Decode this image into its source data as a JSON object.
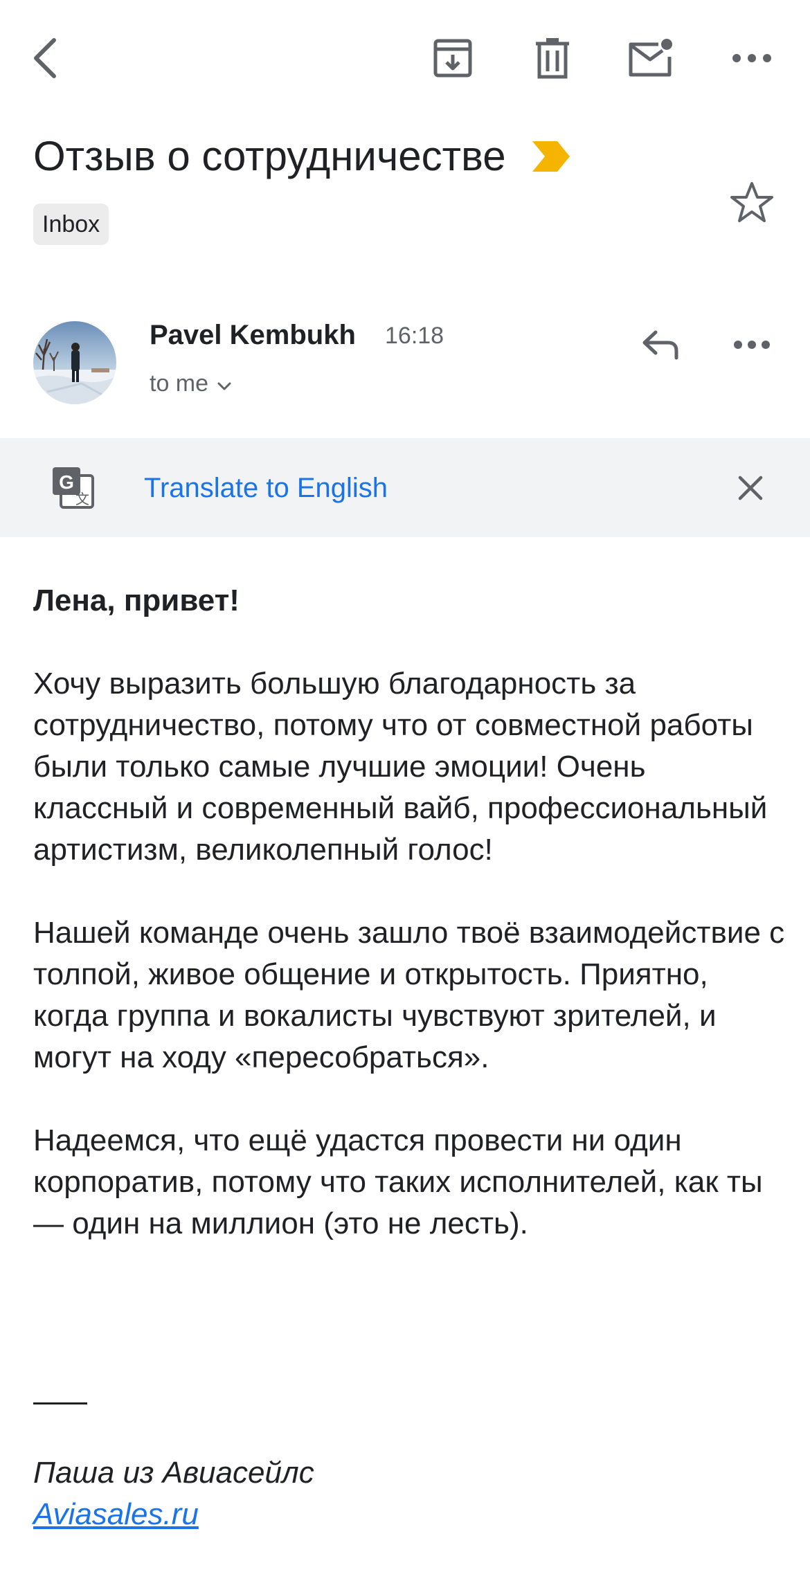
{
  "toolbar": {
    "back_icon": "arrow-back-icon",
    "archive_icon": "archive-icon",
    "delete_icon": "trash-icon",
    "mark_unread_icon": "mark-unread-icon",
    "more_icon": "more-horizontal-icon"
  },
  "message": {
    "subject": "Отзыв о сотрудничестве",
    "importance_color": "#f4b400",
    "label": "Inbox",
    "starred": false
  },
  "sender": {
    "name": "Pavel Kembukh",
    "time": "16:18",
    "recipient": "to me"
  },
  "translate": {
    "link": "Translate to English",
    "link_color": "#1a73e8"
  },
  "body": {
    "greeting": "Лена, привет!",
    "paragraphs": [
      "Хочу выразить большую благодарность за сотрудничество, потому что от совместной работы были только самые лучшие эмоции! Очень классный и современный вайб, профессиональный артистизм, великолепный голос!",
      "Нашей команде очень зашло твоё взаимодействие с толпой, живое общение и открытость. Приятно, когда группа и вокалисты чувствуют зрителей, и могут на ходу «пересобраться».",
      "Надеемся, что ещё удастся провести ни один корпоратив, потому что таких исполнителей, как ты — один на миллион (это не лесть)."
    ],
    "signature_name": "Паша из Авиасейлс",
    "signature_link": "Aviasales.ru"
  }
}
